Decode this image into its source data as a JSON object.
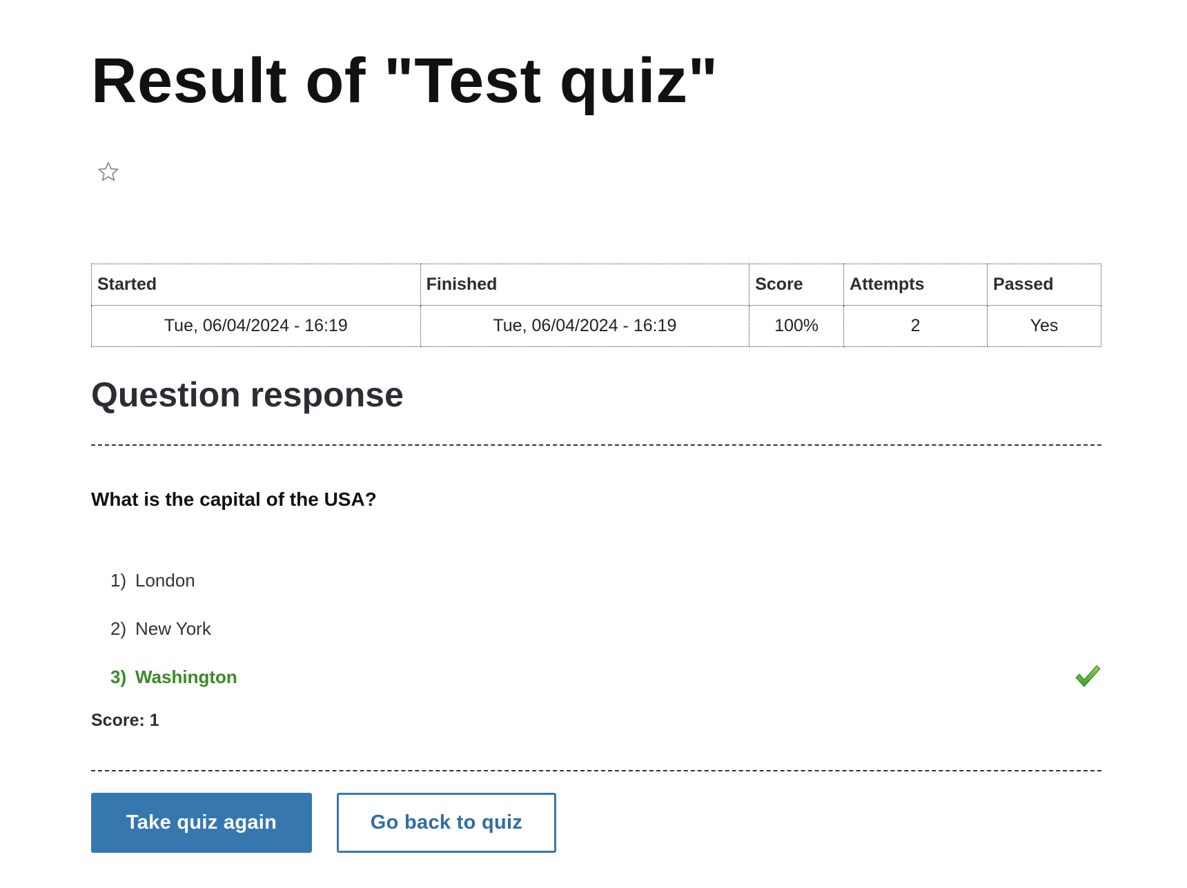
{
  "page": {
    "title": "Result of \"Test quiz\""
  },
  "results_table": {
    "headers": [
      "Started",
      "Finished",
      "Score",
      "Attempts",
      "Passed"
    ],
    "row": {
      "started": "Tue, 06/04/2024 - 16:19",
      "finished": "Tue, 06/04/2024 - 16:19",
      "score": "100%",
      "attempts": "2",
      "passed": "Yes"
    }
  },
  "question_response": {
    "heading": "Question response",
    "question": "What is the capital of the USA?",
    "answers": [
      {
        "number": "1)",
        "label": "London",
        "correct": false
      },
      {
        "number": "2)",
        "label": "New York",
        "correct": false
      },
      {
        "number": "3)",
        "label": "Washington",
        "correct": true
      }
    ],
    "score_text": "Score: 1"
  },
  "actions": {
    "take_again_label": "Take quiz again",
    "go_back_label": "Go back to quiz"
  },
  "colors": {
    "primary_button": "#3677b0",
    "correct_answer": "#3a8a27",
    "check_icon": "#5cb335"
  },
  "icons": {
    "favorite": "star-outline-icon",
    "correct": "checkmark-icon"
  }
}
